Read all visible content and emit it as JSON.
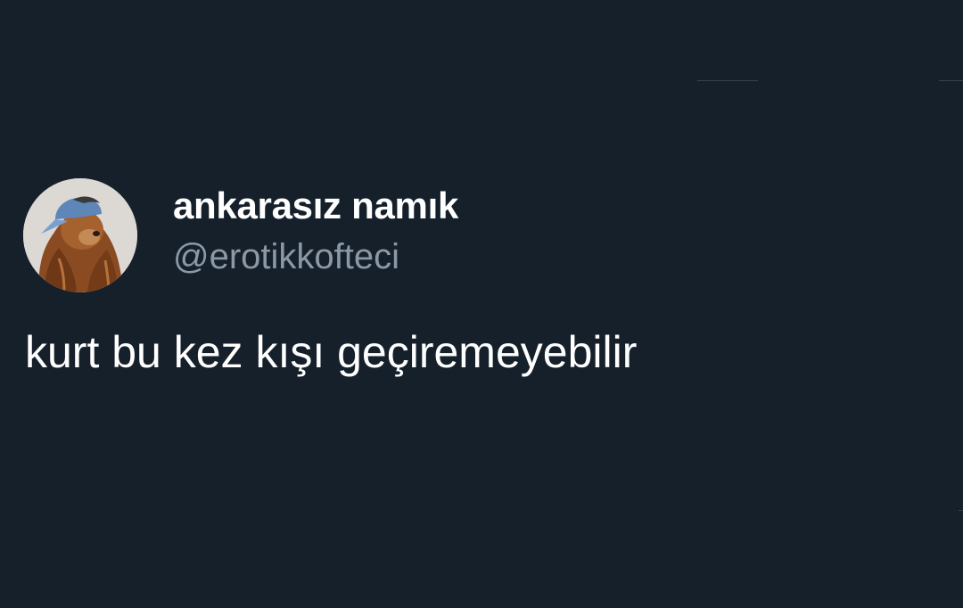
{
  "tweet": {
    "author": {
      "display_name": "ankarasız namık",
      "username": "@erotikkofteci",
      "avatar_icon": "dog-with-cap-avatar"
    },
    "text": "kurt bu kez kışı geçiremeyebilir"
  },
  "colors": {
    "background": "#15202b",
    "primary_text": "#ffffff",
    "secondary_text": "#8b98a5",
    "divider": "#38444d"
  }
}
